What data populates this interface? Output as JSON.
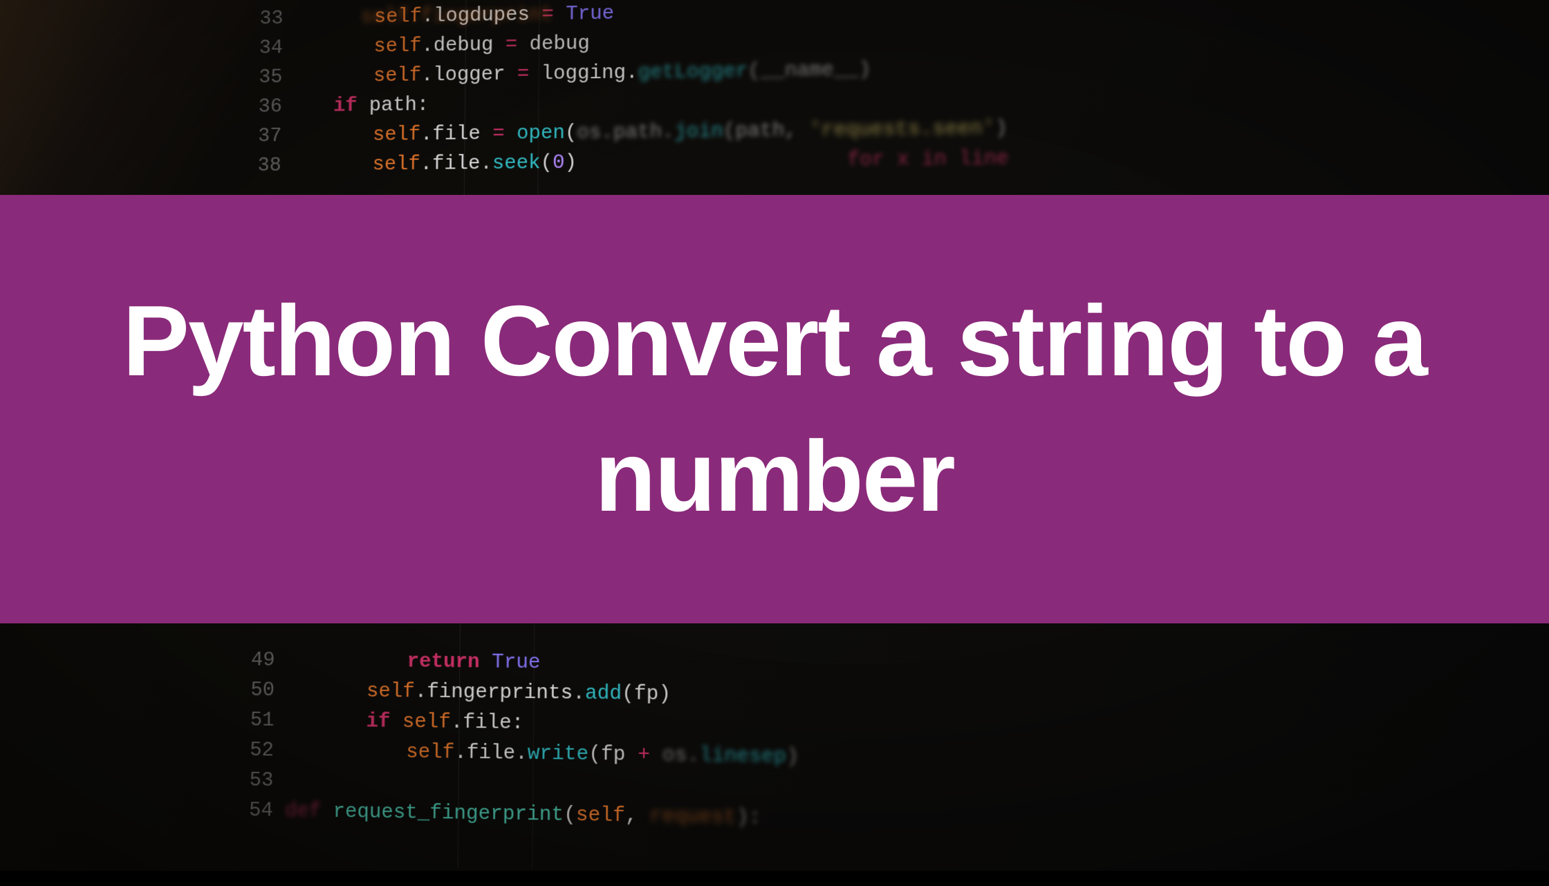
{
  "banner": {
    "title": "Python Convert a string to a number"
  },
  "gutter": {
    "top": [
      "33",
      "34",
      "35",
      "36",
      "37",
      "38"
    ],
    "bottom": [
      "49",
      "50",
      "51",
      "52",
      "53",
      "54"
    ]
  },
  "code": {
    "line33": {
      "self": "self",
      "attr": ".logdupes",
      "op": " = ",
      "val": "True",
      "pre_blur": "self.fingerprint"
    },
    "line34": {
      "self": "self",
      "attr": ".debug",
      "op": " = ",
      "val": "debug"
    },
    "line35": {
      "self": "self",
      "attr": ".logger",
      "op": " = ",
      "fn": "logging",
      "dot": ".",
      "call": "getLogger",
      "args": "(__name__)"
    },
    "line36": {
      "kw": "if",
      "cond": " path:"
    },
    "line37": {
      "self": "self",
      "attr": ".file",
      "op": " = ",
      "fn": "open",
      "paren1": "(",
      "mod": "os.path",
      "dot": ".",
      "call": "join",
      "paren2": "(",
      "arg1": "path",
      "comma": ", ",
      "str": "'requests.seen'",
      "paren3": ")"
    },
    "line38": {
      "self": "self",
      "attr": ".file",
      "dot": ".",
      "call": "seek",
      "paren1": "(",
      "num": "0",
      "paren2": ")",
      "blur_tail": "for x in line"
    },
    "line49": {
      "kw": "return",
      "val": " True"
    },
    "line50": {
      "self": "self",
      "attr": ".fingerprints",
      "dot": ".",
      "call": "add",
      "args": "(fp)"
    },
    "line51": {
      "kw": "if",
      "sp": " ",
      "self": "self",
      "attr": ".file:"
    },
    "line52": {
      "self": "self",
      "attr": ".file",
      "dot": ".",
      "call": "write",
      "paren1": "(",
      "arg1": "fp",
      "op": " + ",
      "mod": "os",
      "dot2": ".",
      "attr2": "linesep",
      "paren2": ")"
    },
    "line54": {
      "kw": "def",
      "sp": " ",
      "fn": "request_fingerprint",
      "paren1": "(",
      "self": "self",
      "comma": ", ",
      "arg": "request",
      "paren2": "):"
    }
  }
}
